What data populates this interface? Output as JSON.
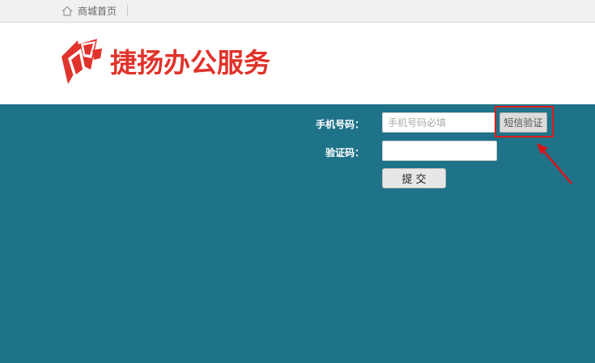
{
  "topbar": {
    "home_label": "商城首页",
    "home_icon": "home-icon"
  },
  "header": {
    "logo_text": "捷扬办公服务",
    "logo_icon": "brand-logo-icon",
    "brand_color": "#e0332b"
  },
  "form": {
    "phone_label": "手机号码：",
    "phone_placeholder": "手机号码必填",
    "phone_value": "",
    "code_label": "验证码：",
    "code_value": "",
    "sms_button_label": "短信验证",
    "submit_label": "提 交"
  },
  "annotation": {
    "highlight_color": "#e01b1b"
  },
  "colors": {
    "main_background": "#1f7389",
    "topbar_background": "#f0f0f0"
  }
}
